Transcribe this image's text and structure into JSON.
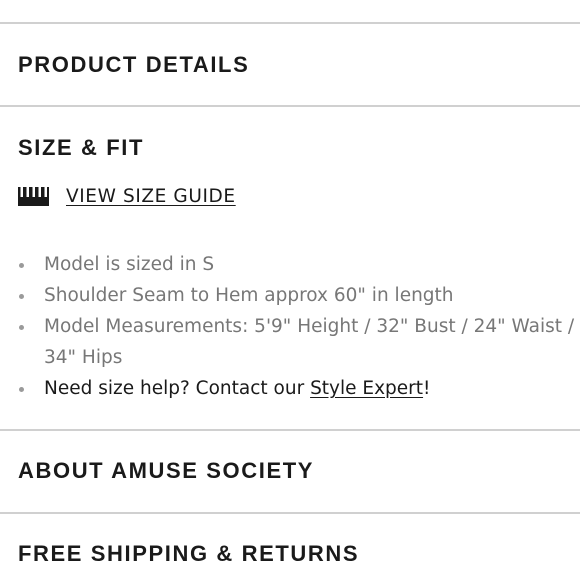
{
  "sections": {
    "product_details": {
      "title": "PRODUCT DETAILS"
    },
    "size_fit": {
      "title": "SIZE & FIT",
      "size_guide": {
        "icon": "ruler-icon",
        "label": "VIEW SIZE GUIDE"
      },
      "bullets": [
        "Model is sized in S",
        "Shoulder Seam to Hem approx 60\" in length",
        "Model Measurements: 5'9\" Height / 32\" Bust / 24\" Waist / 34\" Hips"
      ],
      "help": {
        "text_before": "Need size help? Contact our ",
        "link": "Style Expert",
        "text_after": "!"
      }
    },
    "about": {
      "title": "ABOUT AMUSE SOCIETY"
    },
    "shipping": {
      "title": "FREE SHIPPING & RETURNS"
    }
  },
  "colors": {
    "text_dark": "#1a1a1a",
    "text_muted": "#777777",
    "divider": "#d0d0d0",
    "bullet": "#9a9a9a",
    "background": "#ffffff"
  }
}
